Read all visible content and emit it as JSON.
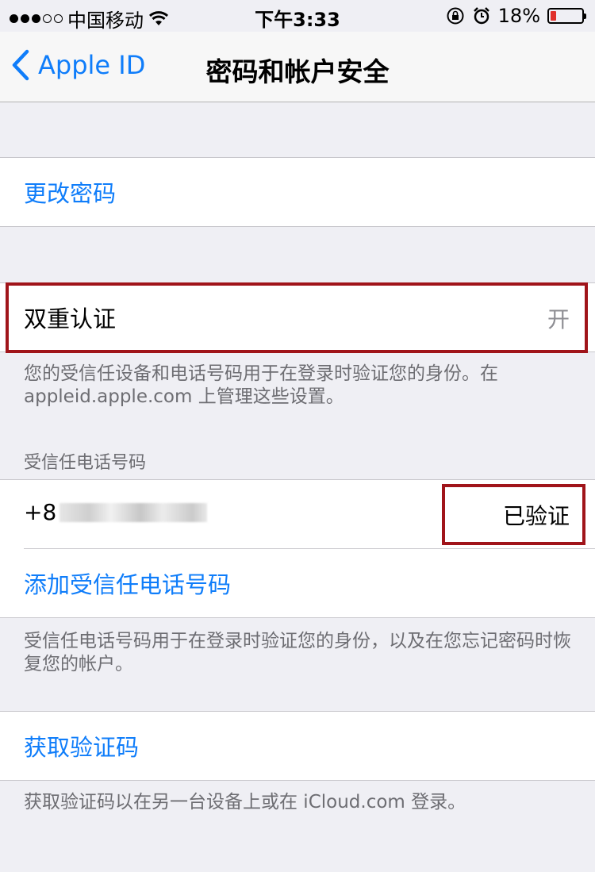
{
  "status_bar": {
    "carrier": "中国移动",
    "time": "下午3:33",
    "battery_percent": "18%",
    "battery_level": 0.18,
    "signal_bars": 3,
    "icons": [
      "wifi-icon",
      "rotation-lock-icon",
      "alarm-icon",
      "battery-icon"
    ]
  },
  "nav": {
    "back_label": "Apple ID",
    "title": "密码和帐户安全"
  },
  "change_password": {
    "label": "更改密码"
  },
  "two_factor": {
    "label": "双重认证",
    "value": "开",
    "footnote": "您的受信任设备和电话号码用于在登录时验证您的身份。在 appleid.apple.com 上管理这些设置。"
  },
  "trusted_numbers": {
    "header": "受信任电话号码",
    "phone_prefix": "+8",
    "status": "已验证",
    "add_label": "添加受信任电话号码",
    "footnote": "受信任电话号码用于在登录时验证您的身份，以及在您忘记密码时恢复您的帐户。"
  },
  "verification_code": {
    "label": "获取验证码",
    "footnote": "获取验证码以在另一台设备上或在 iCloud.com 登录。"
  },
  "colors": {
    "accent": "#0f7dfa",
    "annotation": "#a0141a",
    "battery_low": "#e0302b"
  }
}
